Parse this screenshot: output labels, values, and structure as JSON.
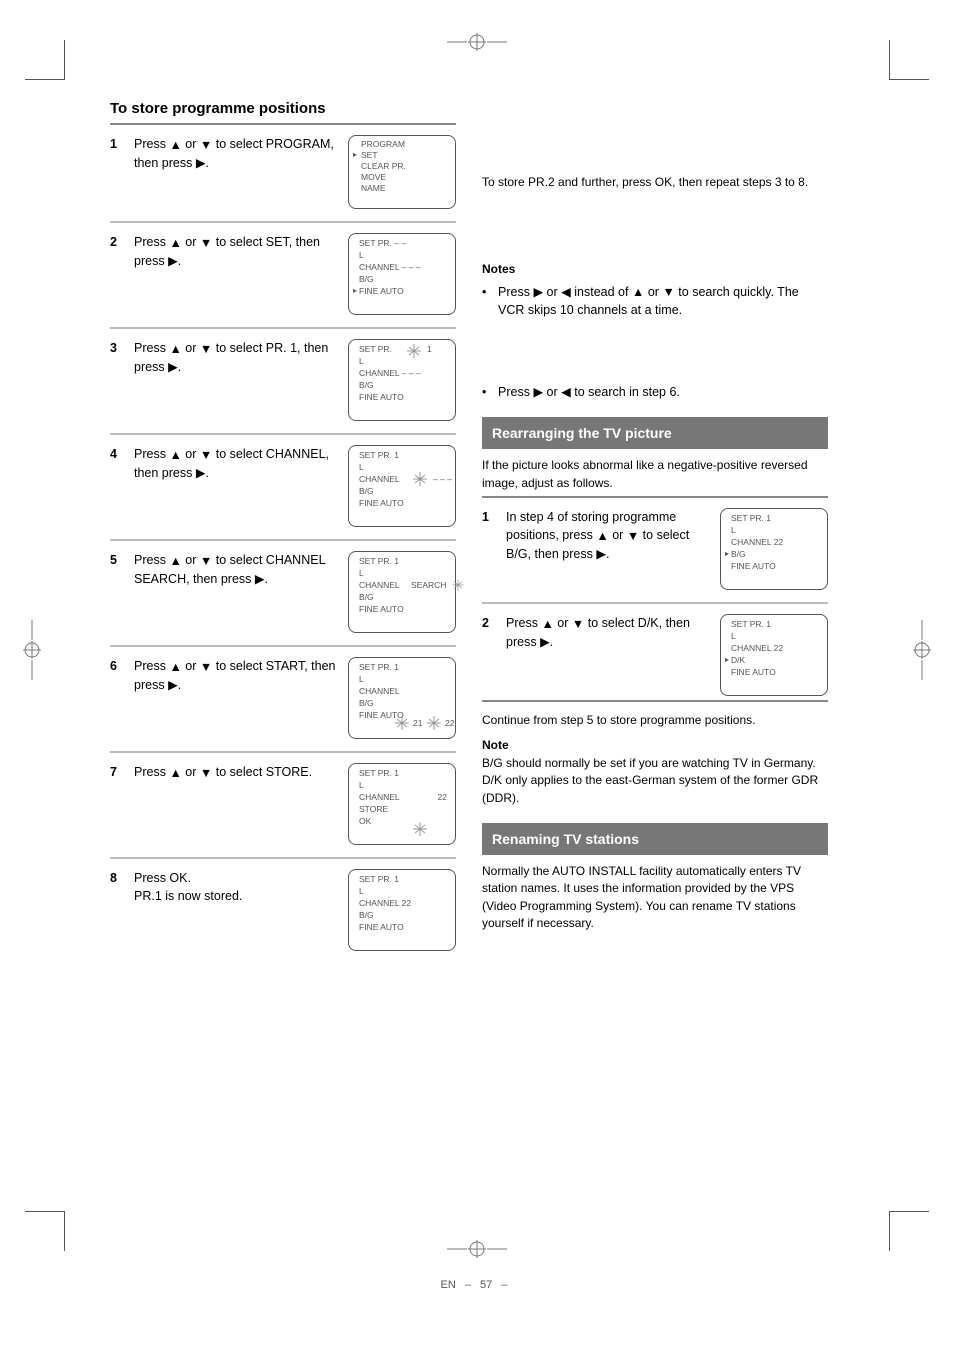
{
  "heading_left": "To store programme positions",
  "steps_left": [
    {
      "num": "1",
      "body_a": "Press",
      "body_b": "or",
      "body_c": "to select PROGRAM, then press",
      "body_d": "."
    },
    {
      "num": "2",
      "body_a": "Press",
      "body_b": "or",
      "body_c": "to select SET, then press",
      "body_d": "."
    },
    {
      "num": "3",
      "body_a": "Press",
      "body_b": "or",
      "body_c": "to select PR. 1, then press",
      "body_d": "."
    },
    {
      "num": "4",
      "body_a": "Press",
      "body_b": "or",
      "body_c": "to select CHANNEL, then press",
      "body_d": "."
    },
    {
      "num": "5",
      "body_a": "Press",
      "body_b": "or",
      "body_c": "to select CHANNEL SEARCH, then press",
      "body_d": "."
    },
    {
      "num": "6",
      "body_a": "Press",
      "body_b": "or",
      "body_c": "to select START, then press",
      "body_d": "."
    },
    {
      "num": "7",
      "body_a": "Press",
      "body_b": "or",
      "body_c": "to select STORE."
    }
  ],
  "step8_a": "Press OK.",
  "step8_b": "PR.1 is now stored.",
  "step8_num": "8",
  "col_r_top_line1": "To store PR.2 and further, press OK, then repeat steps 3 to 8.",
  "notes_title": "Notes",
  "note_bullets": [
    {
      "a": "Press",
      "b": "or",
      "c": "instead of",
      "d": "or",
      "e": "to search quickly. The VCR skips 10 channels at a time."
    },
    {
      "a": "Press",
      "b": "or",
      "c": "to search in step 6."
    }
  ],
  "bar_picture": "Rearranging the TV picture",
  "picture_intro": "If the picture looks abnormal like a negative-positive reversed image, adjust as follows.",
  "picture_steps": [
    {
      "num": "1",
      "a": "In step 4 of storing programme positions, press",
      "b": "or",
      "c": "to select B/G, then press",
      "d": "."
    },
    {
      "num": "2",
      "a": "Press",
      "b": "or",
      "c": "to select D/K, then press",
      "d": "."
    }
  ],
  "picture_after": "Continue from step 5 to store programme positions.",
  "picture_note_title": "Note",
  "picture_note_body": "B/G should normally be set if you are watching TV in Germany. D/K only applies to the east-German system of the former GDR (DDR).",
  "bar_rename": "Renaming TV stations",
  "rename_body": "Normally the AUTO INSTALL facility automatically enters TV station names. It uses the information provided by the VPS (Video Programming System). You can rename TV stations yourself if necessary.",
  "screens": {
    "s1": {
      "l1": "PROGRAM",
      "l2": "SET",
      "l3": "CLEAR PR.",
      "l4": "MOVE",
      "l5": "NAME"
    },
    "s2": {
      "l1": "SET  PR. – –",
      "l2": "L",
      "l3": "CHANNEL  – – –",
      "l4": "B/G",
      "l5": "FINE  AUTO",
      "cursor_top": true
    },
    "s3": {
      "l1": "SET  PR.",
      "l2": "L",
      "l3": "CHANNEL  – – –",
      "l4": "B/G",
      "l5": "FINE  AUTO",
      "pr_val": "1",
      "spark_at": "pr"
    },
    "s4": {
      "l1": "SET  PR.  1",
      "l2": "L",
      "l3": "CHANNEL",
      "l4": "B/G",
      "l5": "FINE  AUTO",
      "ch_val": "– – –",
      "spark_at": "ch"
    },
    "s5": {
      "l1": "SET  PR.  1",
      "l2": "L",
      "l3": "CHANNEL",
      "l4": "B/G",
      "l5": "FINE  AUTO",
      "search": "SEARCH",
      "spark_at": "search"
    },
    "s6": {
      "l1": "SET  PR.  1",
      "l2": "L",
      "l3": "CHANNEL",
      "l4": "B/G",
      "l5": "FINE  AUTO",
      "ch_a": "21",
      "ch_b": "22",
      "spark_two": true
    },
    "s7": {
      "l1": "SET  PR.  1",
      "l2": "L",
      "l3": "CHANNEL",
      "store": "STORE",
      "l5": "OK",
      "ch_a": "22",
      "spark_at": "store"
    },
    "s8": {
      "l1": "SET  PR.  1",
      "l2": "L",
      "l3": "CHANNEL  22",
      "l4": "B/G",
      "l5": "FINE  AUTO"
    },
    "sp1": {
      "l1": "SET  PR.  1",
      "l2": "L",
      "l3": "CHANNEL  22",
      "l4": "B/G",
      "l5": "FINE  AUTO",
      "cursor_row": 4
    },
    "sp2": {
      "l1": "SET  PR.  1",
      "l2": "L",
      "l3": "CHANNEL  22",
      "l4": "D/K",
      "l5": "FINE  AUTO",
      "cursor_row": 4
    }
  },
  "page_no": "57",
  "lang": "EN"
}
